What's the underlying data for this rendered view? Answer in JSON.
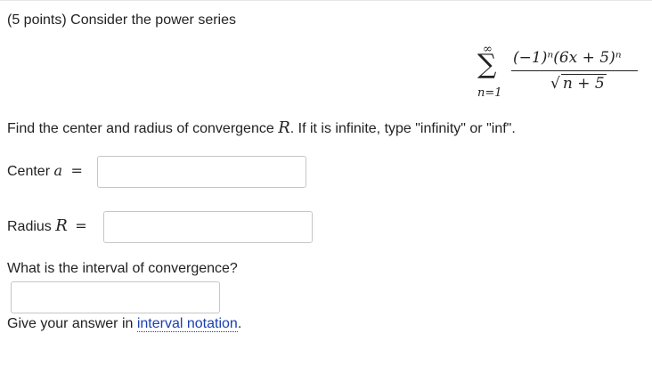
{
  "problem": {
    "header": "(5 points) Consider the power series",
    "series": {
      "sum_symbol": "∑",
      "upper_limit": "∞",
      "lower_limit": "n=1",
      "numerator": "(−1)ⁿ(6x + 5)ⁿ",
      "denominator_radicand": "n + 5",
      "radical_symbol": "√"
    },
    "instruction_prefix": "Find the center and radius of convergence ",
    "instruction_symbol": "R",
    "instruction_suffix": ". If it is infinite, type \"infinity\" or \"inf\"."
  },
  "center": {
    "label": "Center ",
    "variable": "a",
    "equals": "=",
    "value": ""
  },
  "radius": {
    "label": "Radius ",
    "variable": "R",
    "equals": "=",
    "value": ""
  },
  "interval": {
    "question": "What is the interval of convergence?",
    "value": "",
    "hint_prefix": "Give your answer in ",
    "hint_link": "interval notation",
    "hint_suffix": "."
  }
}
